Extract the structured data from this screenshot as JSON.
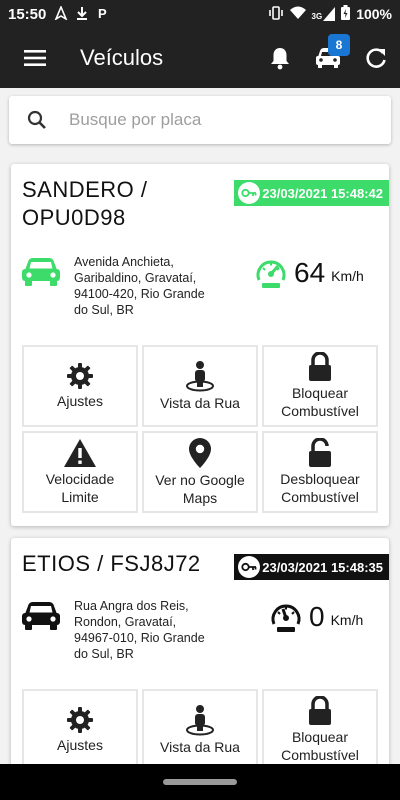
{
  "status_bar": {
    "time": "15:50",
    "network": "3G",
    "battery": "100%"
  },
  "app_bar": {
    "title": "Veículos",
    "badge_count": "8"
  },
  "search": {
    "placeholder": "Busque por placa"
  },
  "vehicles": [
    {
      "name_line1": "SANDERO /",
      "name_line2": "OPU0D98",
      "timestamp": "23/03/2021 15:48:42",
      "status_color": "#3ddc6a",
      "address_lines": [
        "Avenida Anchieta,",
        "Garibaldino, Gravataí,",
        "94100-420, Rio Grande",
        "do Sul, BR"
      ],
      "speed": "64",
      "speed_unit": "Km/h",
      "actions": [
        {
          "icon": "gear-icon",
          "label": "Ajustes"
        },
        {
          "icon": "street-view-icon",
          "label": "Vista da Rua"
        },
        {
          "icon": "lock-icon",
          "label_line1": "Bloquear",
          "label_line2": "Combustível"
        },
        {
          "icon": "warning-icon",
          "label_line1": "Velocidade",
          "label_line2": "Limite"
        },
        {
          "icon": "map-pin-icon",
          "label_line1": "Ver no Google",
          "label_line2": "Maps"
        },
        {
          "icon": "unlock-icon",
          "label_line1": "Desbloquear",
          "label_line2": "Combustível"
        }
      ]
    },
    {
      "name": "ETIOS / FSJ8J72",
      "timestamp": "23/03/2021 15:48:35",
      "status_color": "#111111",
      "address_lines": [
        "Rua Angra dos Reis,",
        "Rondon, Gravataí,",
        "94967-010, Rio Grande",
        "do Sul, BR"
      ],
      "speed": "0",
      "speed_unit": "Km/h",
      "actions": [
        {
          "icon": "gear-icon",
          "label": "Ajustes"
        },
        {
          "icon": "street-view-icon",
          "label": "Vista da Rua"
        },
        {
          "icon": "lock-icon",
          "label_line1": "Bloquear",
          "label_line2": "Combustível"
        }
      ]
    }
  ]
}
